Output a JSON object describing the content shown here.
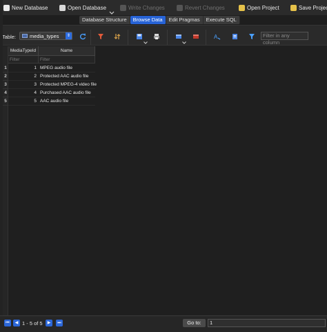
{
  "toolbar": {
    "new_database": "New Database",
    "open_database": "Open Database",
    "write_changes": "Write Changes",
    "revert_changes": "Revert Changes",
    "open_project": "Open Project",
    "save_project": "Save Project"
  },
  "tabs": [
    {
      "label": "Database Structure",
      "active": false
    },
    {
      "label": "Browse Data",
      "active": true
    },
    {
      "label": "Edit Pragmas",
      "active": false
    },
    {
      "label": "Execute SQL",
      "active": false
    }
  ],
  "browse": {
    "table_label": "Table:",
    "table_name": "media_types",
    "filter_any_placeholder": "Filter in any column"
  },
  "grid": {
    "columns": [
      "MediaTypeId",
      "Name"
    ],
    "filter_placeholder": "Filter",
    "rows": [
      {
        "rownum": "1",
        "id": "1",
        "name": "MPEG audio file"
      },
      {
        "rownum": "2",
        "id": "2",
        "name": "Protected AAC audio file"
      },
      {
        "rownum": "3",
        "id": "3",
        "name": "Protected MPEG-4 video file"
      },
      {
        "rownum": "4",
        "id": "4",
        "name": "Purchased AAC audio file"
      },
      {
        "rownum": "5",
        "id": "5",
        "name": "AAC audio file"
      }
    ]
  },
  "footer": {
    "record_count": "1 - 5 of 5",
    "goto_label": "Go to:",
    "goto_value": "1"
  },
  "colors": {
    "accent": "#2763d6",
    "background": "#1e1e1e"
  }
}
